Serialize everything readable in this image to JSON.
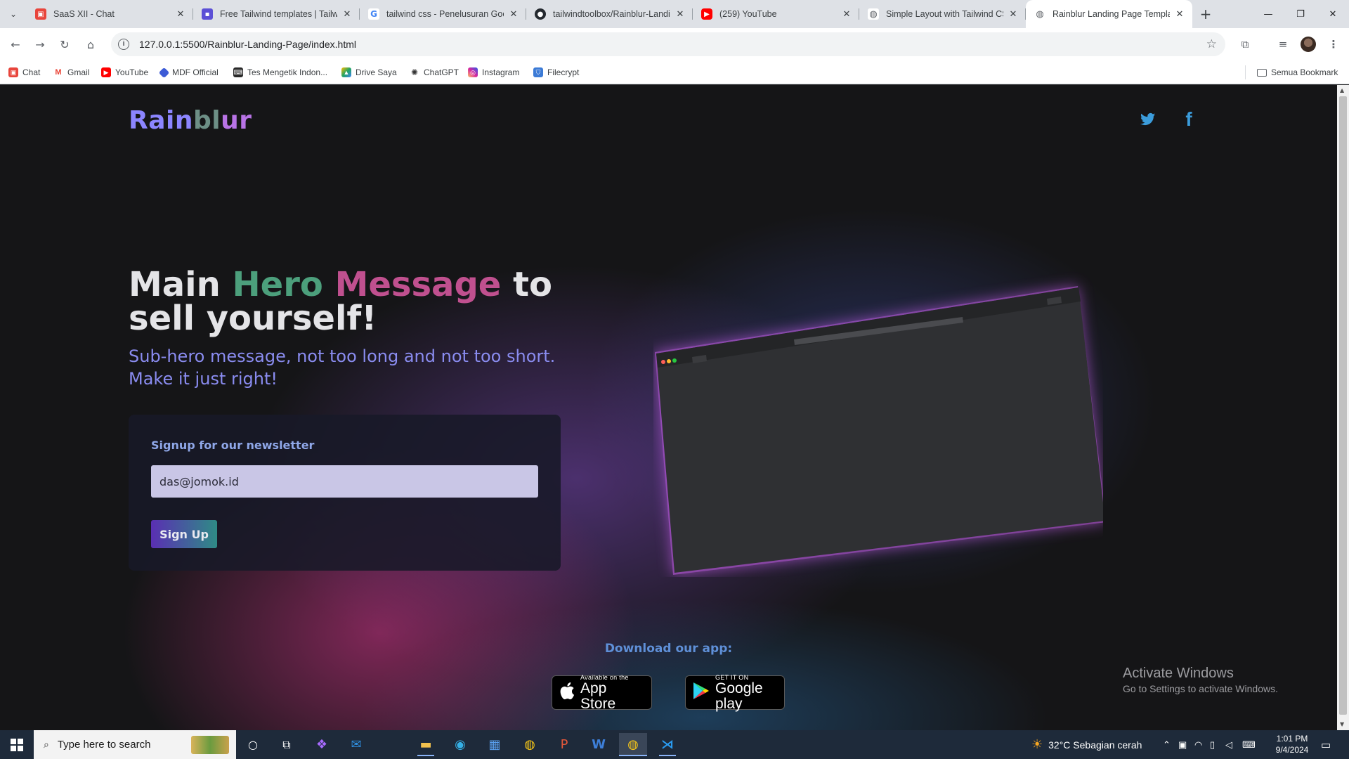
{
  "browser": {
    "tabs": [
      {
        "title": "SaaS XII - Chat",
        "icon": "chat-icon",
        "color": "#e8453c"
      },
      {
        "title": "Free Tailwind templates | Tailwin",
        "icon": "tailwind-icon",
        "color": "#5b4fd6"
      },
      {
        "title": "tailwind css - Penelusuran Goo",
        "icon": "google-icon",
        "color": "#4285f4"
      },
      {
        "title": "tailwindtoolbox/Rainblur-Landi",
        "icon": "github-icon",
        "color": "#24292f"
      },
      {
        "title": "(259) YouTube",
        "icon": "youtube-icon",
        "color": "#ff0000"
      },
      {
        "title": "Simple Layout with Tailwind CS",
        "icon": "globe-icon",
        "color": "#5f6368"
      },
      {
        "title": "Rainblur Landing Page Templat",
        "icon": "globe-icon",
        "color": "#5f6368"
      }
    ],
    "url": "127.0.0.1:5500/Rainblur-Landing-Page/index.html",
    "bookmarks": [
      {
        "label": "Chat",
        "icon": "chat-icon",
        "color": "#e8453c"
      },
      {
        "label": "Gmail",
        "icon": "gmail-icon",
        "color": "#ea4335"
      },
      {
        "label": "YouTube",
        "icon": "youtube-icon",
        "color": "#ff0000"
      },
      {
        "label": "MDF Official",
        "icon": "mdf-icon",
        "color": "#3c5bd6"
      },
      {
        "label": "Tes Mengetik Indon...",
        "icon": "keyboard-icon",
        "color": "#2a2a2a"
      },
      {
        "label": "Drive Saya",
        "icon": "drive-icon",
        "color": "#1fa463"
      },
      {
        "label": "ChatGPT",
        "icon": "chatgpt-icon",
        "color": "#5f6368"
      },
      {
        "label": "Instagram",
        "icon": "instagram-icon",
        "color": "#d6249f"
      },
      {
        "label": "Filecrypt",
        "icon": "shield-icon",
        "color": "#3c7bd6"
      }
    ],
    "all_bookmarks_label": "Semua Bookmark"
  },
  "page": {
    "logo": {
      "part1": "Rain",
      "part2": "bl",
      "part3": "ur"
    },
    "hero": {
      "title_1": "Main ",
      "title_hero": "Hero",
      "title_space": " ",
      "title_message": "Message",
      "title_2": " to sell yourself!",
      "subtitle": "Sub-hero message, not too long and not too short. Make it just right!"
    },
    "newsletter": {
      "label": "Signup for our newsletter",
      "email_value": "das@jomok.id",
      "button": "Sign Up"
    },
    "download": {
      "label": "Download our app:",
      "appstore_small": "Available on the",
      "appstore_big": "App Store",
      "googleplay_small": "GET IT ON",
      "googleplay_big": "Google play"
    }
  },
  "overlay": {
    "activate_title": "Activate Windows",
    "activate_sub": "Go to Settings to activate Windows."
  },
  "taskbar": {
    "search_placeholder": "Type here to search",
    "weather": "32°C  Sebagian cerah",
    "time": "1:01 PM",
    "date": "9/4/2024"
  },
  "colors": {
    "logo_primary": "#8c85ff",
    "hero_green": "#4c9f7c",
    "hero_pink": "#c0508f",
    "subtitle": "#8a8cf0",
    "accent_blue": "#5f90d8"
  }
}
